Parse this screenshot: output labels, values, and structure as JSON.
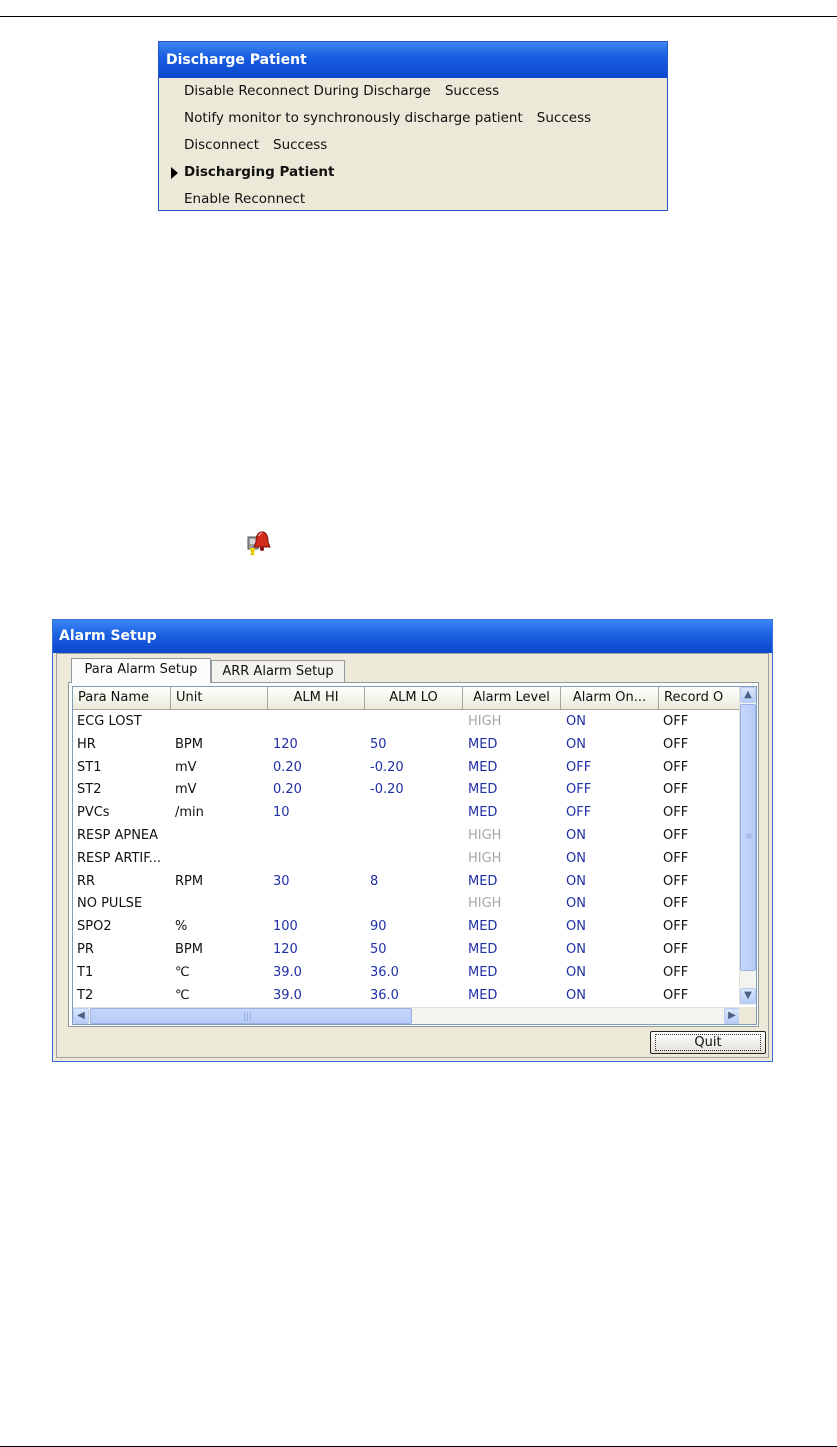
{
  "discharge_dialog": {
    "title": "Discharge Patient",
    "steps": [
      {
        "label": "Disable Reconnect During Discharge",
        "status": "Success"
      },
      {
        "label": "Notify monitor to synchronously discharge patient",
        "status": "Success"
      },
      {
        "label": "Disconnect",
        "status": "Success"
      },
      {
        "label": "Discharging Patient",
        "status": "",
        "current": true
      },
      {
        "label": "Enable Reconnect",
        "status": ""
      }
    ]
  },
  "alarm_icon": {
    "icon": "alarm-bell-icon"
  },
  "alarm_setup": {
    "title": "Alarm Setup",
    "tabs": [
      "Para Alarm Setup",
      "ARR Alarm Setup"
    ],
    "active_tab": "Para Alarm Setup",
    "columns": [
      "Para Name",
      "Unit",
      "ALM HI",
      "ALM LO",
      "Alarm Level",
      "Alarm On...",
      "Record O"
    ],
    "rows": [
      {
        "name": "ECG LOST",
        "unit": "",
        "hi": "",
        "lo": "",
        "level": "HIGH",
        "on": "ON",
        "record": "OFF"
      },
      {
        "name": "HR",
        "unit": "BPM",
        "hi": "120",
        "lo": "50",
        "level": "MED",
        "on": "ON",
        "record": "OFF"
      },
      {
        "name": "ST1",
        "unit": "mV",
        "hi": "0.20",
        "lo": "-0.20",
        "level": "MED",
        "on": "OFF",
        "record": "OFF"
      },
      {
        "name": "ST2",
        "unit": "mV",
        "hi": "0.20",
        "lo": "-0.20",
        "level": "MED",
        "on": "OFF",
        "record": "OFF"
      },
      {
        "name": "PVCs",
        "unit": "/min",
        "hi": "10",
        "lo": "",
        "level": "MED",
        "on": "OFF",
        "record": "OFF"
      },
      {
        "name": "RESP APNEA",
        "unit": "",
        "hi": "",
        "lo": "",
        "level": "HIGH",
        "on": "ON",
        "record": "OFF"
      },
      {
        "name": "RESP ARTIF...",
        "unit": "",
        "hi": "",
        "lo": "",
        "level": "HIGH",
        "on": "ON",
        "record": "OFF"
      },
      {
        "name": "RR",
        "unit": "RPM",
        "hi": "30",
        "lo": "8",
        "level": "MED",
        "on": "ON",
        "record": "OFF"
      },
      {
        "name": "NO PULSE",
        "unit": "",
        "hi": "",
        "lo": "",
        "level": "HIGH",
        "on": "ON",
        "record": "OFF"
      },
      {
        "name": "SPO2",
        "unit": "%",
        "hi": "100",
        "lo": "90",
        "level": "MED",
        "on": "ON",
        "record": "OFF"
      },
      {
        "name": "PR",
        "unit": "BPM",
        "hi": "120",
        "lo": "50",
        "level": "MED",
        "on": "ON",
        "record": "OFF"
      },
      {
        "name": "T1",
        "unit": "℃",
        "hi": "39.0",
        "lo": "36.0",
        "level": "MED",
        "on": "ON",
        "record": "OFF"
      },
      {
        "name": "T2",
        "unit": "℃",
        "hi": "39.0",
        "lo": "36.0",
        "level": "MED",
        "on": "ON",
        "record": "OFF"
      }
    ],
    "quit_label": "Quit",
    "colors": {
      "value_blue": "#1f30a4",
      "disabled_gray": "#a6a6a6",
      "titlebar_blue": "#0a48cf"
    }
  }
}
